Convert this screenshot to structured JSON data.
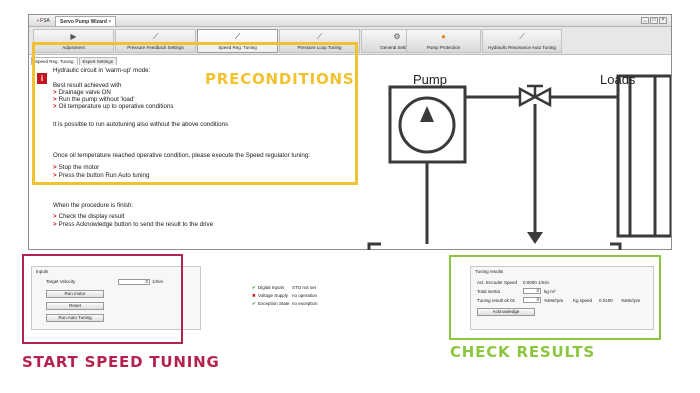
{
  "window": {
    "app_tab": "FSA",
    "active_tab": "Servo Pump Wizard",
    "controls": [
      "_",
      "□",
      "×"
    ]
  },
  "toolbar": {
    "items": [
      {
        "label": "Adjustment",
        "icon": "play-icon"
      },
      {
        "label": "Pressure Feedback Settings",
        "icon": "gauge-icon"
      },
      {
        "label": "Speed Reg. Tuning",
        "icon": "tuning-icon"
      },
      {
        "label": "Pressure Loop Tuning",
        "icon": "loop-icon"
      },
      {
        "label": "General Settings",
        "icon": "gear-icon"
      },
      {
        "label": "Pump Protection",
        "icon": "shield-icon"
      },
      {
        "label": "Hydraulic Resonance Auto Tuning",
        "icon": "chart-icon"
      }
    ],
    "active_index": 2
  },
  "subtabs": [
    "Speed Reg. Tuning",
    "Expert Settings"
  ],
  "instructions": {
    "intro": "Hydraulic circuit in 'warm-up' mode:",
    "best_result": "Best result achieved with",
    "conditions": [
      "Drainage valve ON",
      "Run the pump without 'load'",
      "Oil temperature up to operative conditions"
    ],
    "autotune_note": "It is possible to run autotuning also without the above conditions",
    "operative": "Once oil temperature reached operative condition, please execute the Speed regulator tuning:",
    "operative_steps": [
      "Stop the motor",
      "Press the button Run Auto tuning"
    ],
    "finish": "When the procedure is finish:",
    "finish_steps": [
      "Check the display result",
      "Press Acknowledge button to send the result to the drive"
    ]
  },
  "diagram": {
    "pump_label": "Pump",
    "loads_label": "Loads"
  },
  "inputs_panel": {
    "title": "Inputs",
    "target_velocity_label": "Target Velocity",
    "target_velocity_value": "0",
    "target_velocity_unit": "1/min",
    "run_motor": "Run motor",
    "reset": "Reset",
    "run_auto_tuning": "Run Auto Tuning"
  },
  "status": [
    {
      "label": "Digital Inputs",
      "value": "STO not set",
      "ok": true
    },
    {
      "label": "Voltage Supply",
      "value": "no operation",
      "ok": false
    },
    {
      "label": "Exception State",
      "value": "no exception",
      "ok": true
    }
  ],
  "tuning_results": {
    "title": "Tuning results",
    "encoder_label": "Act. Encoder Speed",
    "encoder_value": "0.0000 1/min",
    "inertia_label": "Total inertia",
    "inertia_value": "0",
    "inertia_unit": "kg·m²",
    "result_label": "Tuning result ok 01",
    "result_value": "0",
    "result_unit": "%Mn/rpm",
    "kg_speed_label": "Kg speed",
    "kg_speed_value": "0.0100",
    "kg_speed_unit": "%Mn/rpm",
    "acknowledge": "Acknowledge"
  },
  "callouts": {
    "preconditions": "PRECONDITIONS",
    "start_speed_tuning": "START SPEED TUNING",
    "check_results": "CHECK RESULTS"
  },
  "colors": {
    "preconditions": "#f2c12e",
    "start_speed_tuning": "#b5224e",
    "check_results": "#8cc63f",
    "bullet": "#c4151c"
  }
}
